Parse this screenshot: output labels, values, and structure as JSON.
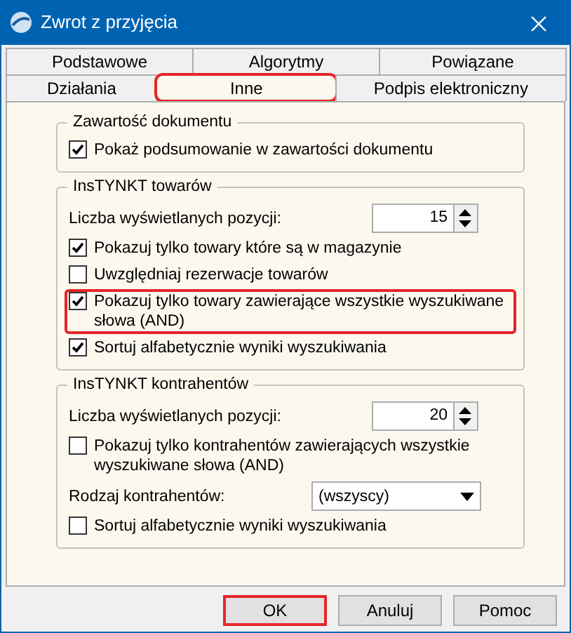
{
  "window": {
    "title": "Zwrot z przyjęcia"
  },
  "tab_rows": [
    [
      {
        "label": "Podstawowe",
        "selected": false,
        "highlighted": false
      },
      {
        "label": "Algorytmy",
        "selected": false,
        "highlighted": false
      },
      {
        "label": "Powiązane",
        "selected": false,
        "highlighted": false
      }
    ],
    [
      {
        "label": "Działania",
        "selected": false,
        "highlighted": false
      },
      {
        "label": "Inne",
        "selected": true,
        "highlighted": true
      },
      {
        "label": "Podpis elektroniczny",
        "selected": false,
        "highlighted": false
      }
    ]
  ],
  "groups": [
    {
      "title": "Zawartość dokumentu",
      "items": [
        {
          "kind": "checkbox",
          "label": "Pokaż podsumowanie w zawartości dokumentu",
          "checked": true,
          "highlighted": false
        }
      ]
    },
    {
      "title": "InsTYNKT towarów",
      "items": [
        {
          "kind": "spinner",
          "label": "Liczba wyświetlanych pozycji:",
          "value": "15"
        },
        {
          "kind": "checkbox",
          "label": "Pokazuj tylko towary które są w magazynie",
          "checked": true,
          "highlighted": false
        },
        {
          "kind": "checkbox",
          "label": "Uwzględniaj rezerwacje towarów",
          "checked": false,
          "highlighted": false
        },
        {
          "kind": "checkbox",
          "label": "Pokazuj tylko towary zawierające wszystkie wyszukiwane słowa (AND)",
          "checked": true,
          "highlighted": true
        },
        {
          "kind": "checkbox",
          "label": "Sortuj alfabetycznie wyniki wyszukiwania",
          "checked": true,
          "highlighted": false
        }
      ]
    },
    {
      "title": "InsTYNKT kontrahentów",
      "items": [
        {
          "kind": "spinner",
          "label": "Liczba wyświetlanych pozycji:",
          "value": "20"
        },
        {
          "kind": "checkbox",
          "label": "Pokazuj tylko kontrahentów zawierających wszystkie wyszukiwane słowa (AND)",
          "checked": false,
          "highlighted": false
        },
        {
          "kind": "select",
          "label": "Rodzaj kontrahentów:",
          "value": "(wszyscy)"
        },
        {
          "kind": "checkbox",
          "label": "Sortuj alfabetycznie wyniki wyszukiwania",
          "checked": false,
          "highlighted": false
        }
      ]
    }
  ],
  "buttons": [
    {
      "label": "OK",
      "highlighted": true
    },
    {
      "label": "Anuluj",
      "highlighted": false
    },
    {
      "label": "Pomoc",
      "highlighted": false
    }
  ]
}
